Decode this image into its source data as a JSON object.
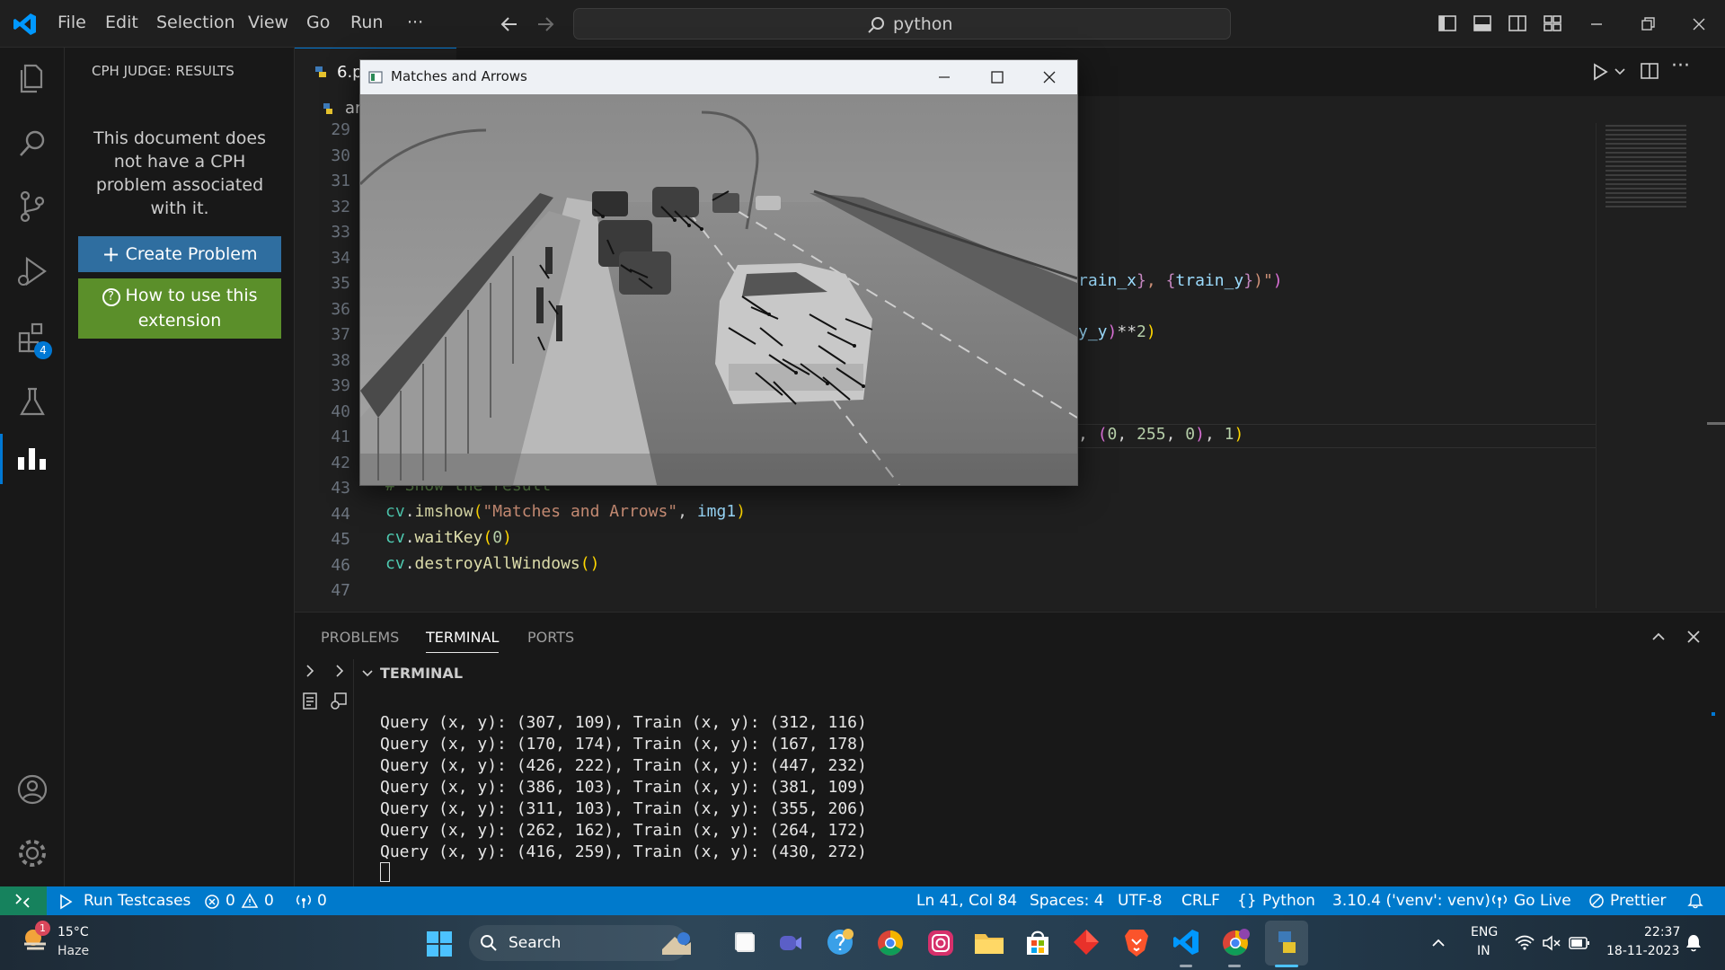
{
  "titlebar": {
    "menu": [
      "File",
      "Edit",
      "Selection",
      "View",
      "Go",
      "Run",
      "···"
    ],
    "search_text": "python"
  },
  "activity": {
    "extensions_badge": "4"
  },
  "sidebar": {
    "title": "CPH JUDGE: RESULTS",
    "message": "This document does not have a CPH problem associated with it.",
    "create_button": "Create Problem",
    "howto_button": "How to use this extension"
  },
  "editor": {
    "tab1": "6.p",
    "breadcrumb": "ar",
    "line_numbers": [
      "29",
      "30",
      "31",
      "32",
      "33",
      "34",
      "35",
      "36",
      "37",
      "38",
      "39",
      "40",
      "41",
      "42",
      "43",
      "44",
      "45",
      "46",
      "47"
    ],
    "code_35_tail": "rain_x}, {train_y})\")",
    "code_37_tail": "y_y)**2)",
    "code_41_tail": ", (0, 255, 0), 1)",
    "code_43": "# Show the result",
    "code_44": "cv.imshow(\"Matches and Arrows\", img1)",
    "code_45": "cv.waitKey(0)",
    "code_46": "cv.destroyAllWindows()"
  },
  "cv_window": {
    "title": "Matches and Arrows"
  },
  "panel": {
    "tabs": [
      "PROBLEMS",
      "TERMINAL",
      "PORTS"
    ],
    "section_title": "TERMINAL",
    "lines": [
      "Query (x, y): (307, 109), Train (x, y): (312, 116)",
      "Query (x, y): (170, 174), Train (x, y): (167, 178)",
      "Query (x, y): (426, 222), Train (x, y): (447, 232)",
      "Query (x, y): (386, 103), Train (x, y): (381, 109)",
      "Query (x, y): (311, 103), Train (x, y): (355, 206)",
      "Query (x, y): (262, 162), Train (x, y): (264, 172)",
      "Query (x, y): (416, 259), Train (x, y): (430, 272)"
    ]
  },
  "statusbar": {
    "run_testcases": "Run Testcases",
    "errors": "0",
    "warnings": "0",
    "ports": "0",
    "position": "Ln 41, Col 84",
    "spaces": "Spaces: 4",
    "encoding": "UTF-8",
    "eol": "CRLF",
    "language": "Python",
    "interpreter": "3.10.4 ('venv': venv)",
    "golive": "Go Live",
    "prettier": "Prettier"
  },
  "taskbar": {
    "weather_temp": "15°C",
    "weather_desc": "Haze",
    "weather_badge": "1",
    "search_label": "Search",
    "lang_top": "ENG",
    "lang_bottom": "IN",
    "time": "22:37",
    "date": "18-11-2023"
  }
}
